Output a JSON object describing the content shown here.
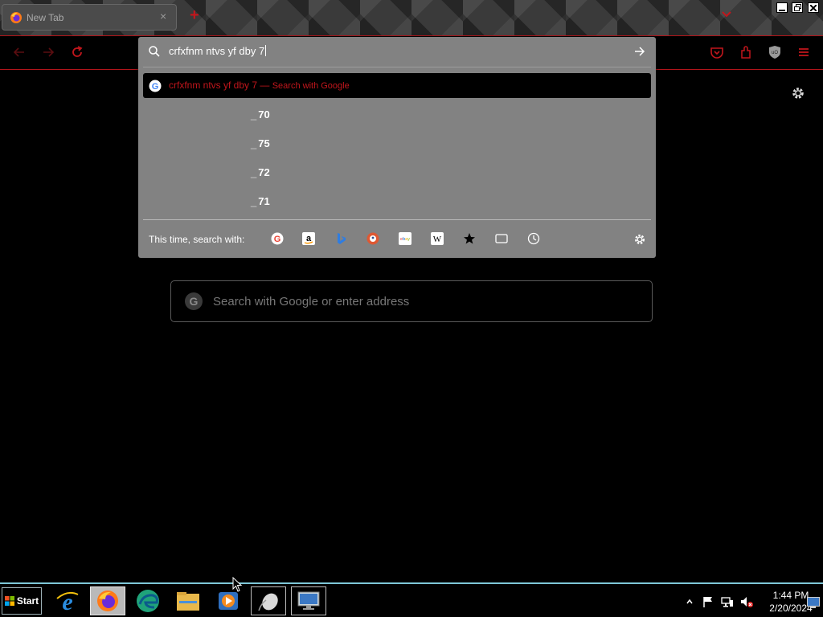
{
  "browser": {
    "tab": {
      "title": "New Tab",
      "close_glyph": "×"
    },
    "new_tab_glyph": "+",
    "window_buttons": [
      "minimize",
      "restore",
      "close"
    ]
  },
  "toolbar": {
    "icons": [
      "back-icon",
      "forward-icon",
      "reload-icon",
      "pocket-icon",
      "extensions-icon",
      "ublock-icon",
      "menu-icon"
    ]
  },
  "urlbar": {
    "value": "crfxfnm ntvs yf dby 7",
    "selected_result": {
      "query": "crfxfnm ntvs yf dby 7",
      "separator": " — ",
      "action": "Search with Google"
    },
    "suggestions": [
      {
        "prefix": "_",
        "text": "70"
      },
      {
        "prefix": "_",
        "text": "75"
      },
      {
        "prefix": "_",
        "text": "72"
      },
      {
        "prefix": "_",
        "text": "71"
      }
    ],
    "one_off_label": "This time, search with:",
    "one_off_engines": [
      "google",
      "amazon",
      "bing",
      "duckduckgo",
      "ebay",
      "wikipedia",
      "bookmarks",
      "tabs",
      "history"
    ]
  },
  "page": {
    "search_placeholder": "Search with Google or enter address"
  },
  "taskbar": {
    "start_label": "Start",
    "apps": [
      "internet-explorer",
      "firefox",
      "edge",
      "file-explorer",
      "media-player",
      "mouse-settings",
      "remote-desktop"
    ],
    "clock_time": "1:44 PM",
    "clock_date": "2/20/2024"
  },
  "colors": {
    "accent": "#c2161c",
    "popup_bg": "#828282",
    "taskbar_border": "#7ec7d8"
  }
}
